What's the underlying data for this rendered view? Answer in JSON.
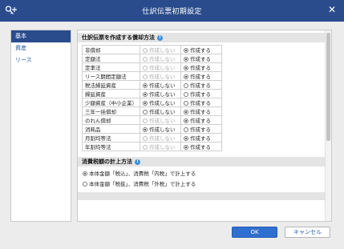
{
  "window": {
    "title": "仕訳伝票初期設定",
    "close_label": "✕"
  },
  "colors": {
    "titlebar": "#2a4c8c",
    "accent": "#2f6fcf"
  },
  "sidebar": {
    "items": [
      {
        "label": "基本",
        "active": true
      },
      {
        "label": "資産",
        "active": false
      },
      {
        "label": "リース",
        "active": false
      }
    ]
  },
  "section_method": {
    "title": "仕訳伝票を作成する償却方法",
    "option_no": "作成しない",
    "option_yes": "作成する",
    "rows": [
      {
        "label": "非償却",
        "selected": "yes",
        "no_disabled": true
      },
      {
        "label": "定額法",
        "selected": "yes",
        "no_disabled": true
      },
      {
        "label": "定率法",
        "selected": "yes",
        "no_disabled": true
      },
      {
        "label": "リース期間定額法",
        "selected": "yes",
        "no_disabled": true
      },
      {
        "label": "税法繰延資産",
        "selected": "no",
        "no_disabled": false
      },
      {
        "label": "繰延資産",
        "selected": "no",
        "no_disabled": false
      },
      {
        "label": "少額資産（中小企業）",
        "selected": "no",
        "no_disabled": false
      },
      {
        "label": "三年一括償却",
        "selected": "yes",
        "no_disabled": false
      },
      {
        "label": "のれん償却",
        "selected": "yes",
        "no_disabled": true
      },
      {
        "label": "消耗品",
        "selected": "no",
        "no_disabled": false
      },
      {
        "label": "月割均等法",
        "selected": "yes",
        "no_disabled": true
      },
      {
        "label": "年割均等法",
        "selected": "yes",
        "no_disabled": true
      }
    ]
  },
  "section_tax": {
    "title": "消費税額の計上方法",
    "options": [
      {
        "label": "本体金額「税込」、消費税「内税」で計上する",
        "selected": true
      },
      {
        "label": "本体金額「税抜」、消費税「外税」で計上する",
        "selected": false
      }
    ]
  },
  "buttons": {
    "ok": "OK",
    "cancel": "キャンセル"
  }
}
